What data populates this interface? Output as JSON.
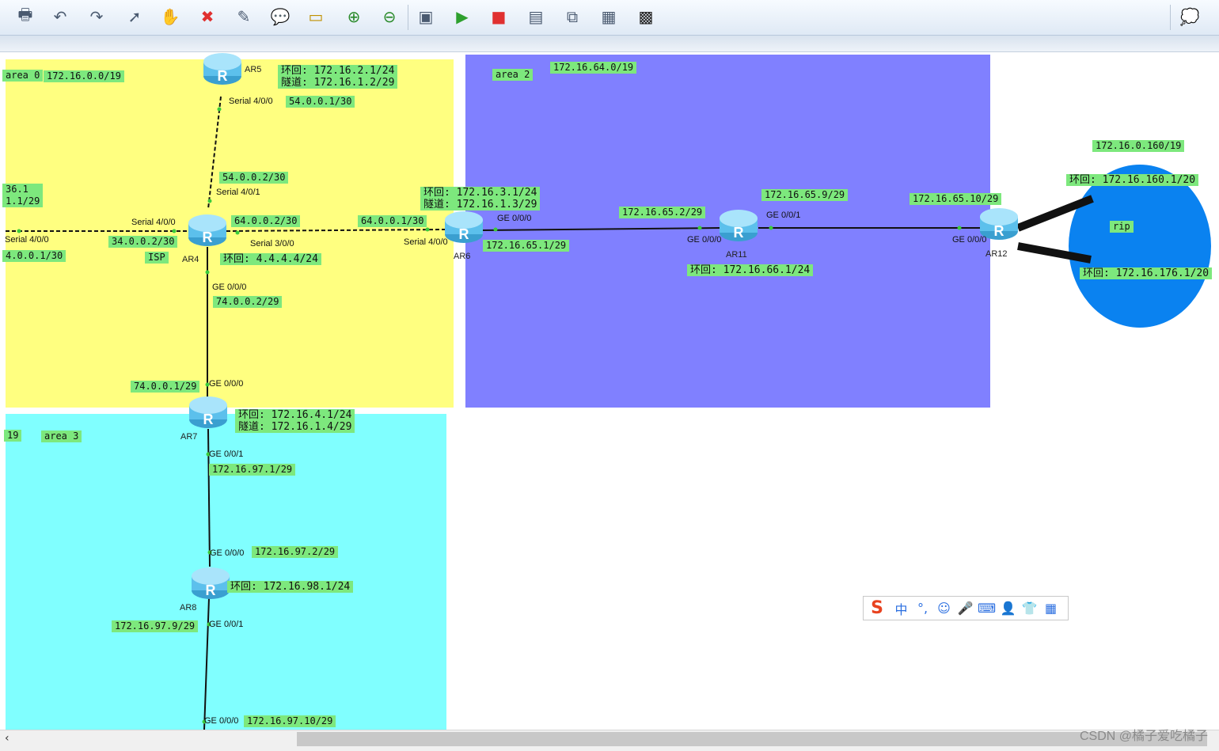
{
  "toolbar": {
    "buttons": [
      {
        "name": "print-icon",
        "glyph": "🖶"
      },
      {
        "name": "undo-icon",
        "glyph": "↶"
      },
      {
        "name": "redo-icon",
        "glyph": "↷"
      },
      {
        "name": "pointer-icon",
        "glyph": "➚"
      },
      {
        "name": "hand-icon",
        "glyph": "✋"
      },
      {
        "name": "delete-icon",
        "glyph": "✖"
      },
      {
        "name": "clear-link-icon",
        "glyph": "✎"
      },
      {
        "name": "text-comment-icon",
        "glyph": "💬"
      },
      {
        "name": "rectangle-icon",
        "glyph": "▭"
      },
      {
        "name": "zoom-in-icon",
        "glyph": "⊕"
      },
      {
        "name": "zoom-out-icon",
        "glyph": "⊖"
      },
      {
        "name": "fit-screen-icon",
        "glyph": "▣"
      },
      {
        "name": "start-device-icon",
        "glyph": "▶"
      },
      {
        "name": "stop-device-icon",
        "glyph": "■"
      },
      {
        "name": "capture-icon",
        "glyph": "▤"
      },
      {
        "name": "topology-icon",
        "glyph": "⧉"
      },
      {
        "name": "grid-icon",
        "glyph": "▦"
      },
      {
        "name": "console-icon",
        "glyph": "▩"
      },
      {
        "name": "chat-icon",
        "glyph": "💭"
      }
    ]
  },
  "areas": {
    "area0_label": "area 0",
    "area0_net": "172.16.0.0/19",
    "area2_label": "area 2",
    "area2_net": "172.16.64.0/19",
    "area3_label": "area 3",
    "area3_net_partial": "19",
    "rip_label": "rip",
    "rip_net": "172.16.0.160/19"
  },
  "routers": {
    "ar4": "AR4",
    "ar5": "AR5",
    "ar6": "AR6",
    "ar7": "AR7",
    "ar8": "AR8",
    "ar11": "AR11",
    "ar12": "AR12"
  },
  "labels": {
    "ar5_loop": "环回: 172.16.2.1/24\n隧道: 172.16.1.2/29",
    "ar5_s400_ip": "54.0.0.1/30",
    "ar4_s401_ip": "54.0.0.2/30",
    "left_partial": "36.1\n1.1/29",
    "ar4_s300_ip": "64.0.0.2/30",
    "ar4_s400_ip": "34.0.0.2/30",
    "isp": "ISP",
    "left_s400_ip": "4.0.0.1/30",
    "ar4_loop": "环回: 4.4.4.4/24",
    "ar4_ge000_ip": "74.0.0.2/29",
    "ar6_s400_ip": "64.0.0.1/30",
    "ar6_loop": "环回: 172.16.3.1/24\n隧道: 172.16.1.3/29",
    "ar6_ge000_ip": "172.16.65.1/29",
    "ar11_ge000_ip": "172.16.65.2/29",
    "ar11_ge001_ip": "172.16.65.9/29",
    "ar11_loop": "环回: 172.16.66.1/24",
    "ar12_ge000_ip": "172.16.65.10/29",
    "ar12_loop1": "环回: 172.16.160.1/20",
    "ar12_loop2": "环回: 172.16.176.1/20",
    "ar7_ge000_ip": "74.0.0.1/29",
    "ar7_loop": "环回: 172.16.4.1/24\n隧道: 172.16.1.4/29",
    "ar7_ge001_ip": "172.16.97.1/29",
    "ar8_ge000_ip": "172.16.97.2/29",
    "ar8_loop": "环回: 172.16.98.1/24",
    "ar8_ge001_ip": "172.16.97.9/29",
    "bottom_ge000_ip": "172.16.97.10/29"
  },
  "ports": {
    "ar5_s400": "Serial 4/0/0",
    "ar4_s401": "Serial 4/0/1",
    "ar4_s400": "Serial 4/0/0",
    "left_s400": "Serial 4/0/0",
    "ar4_s300": "Serial 3/0/0",
    "ar4_ge000": "GE 0/0/0",
    "ar6_s400": "Serial 4/0/0",
    "ar6_ge000": "GE 0/0/0",
    "ar11_ge000": "GE 0/0/0",
    "ar11_ge001": "GE 0/0/1",
    "ar12_ge000": "GE 0/0/0",
    "ar7_ge000": "GE 0/0/0",
    "ar7_ge001": "GE 0/0/1",
    "ar8_ge000": "GE 0/0/0",
    "ar8_ge001": "GE 0/0/1",
    "bottom_ge000": "GE 0/0/0"
  },
  "ime": {
    "logo": "S",
    "items": [
      "中",
      "°,",
      "☺",
      "🎤",
      "⌨",
      "👤",
      "👕",
      "▦"
    ]
  },
  "watermark": "CSDN @橘子爱吃橘子",
  "colors": {
    "area0": "#ffff80",
    "area2": "#8080ff",
    "area3": "#80ffff",
    "rip": "#0a82f0",
    "label_bg": "#7de87d"
  }
}
